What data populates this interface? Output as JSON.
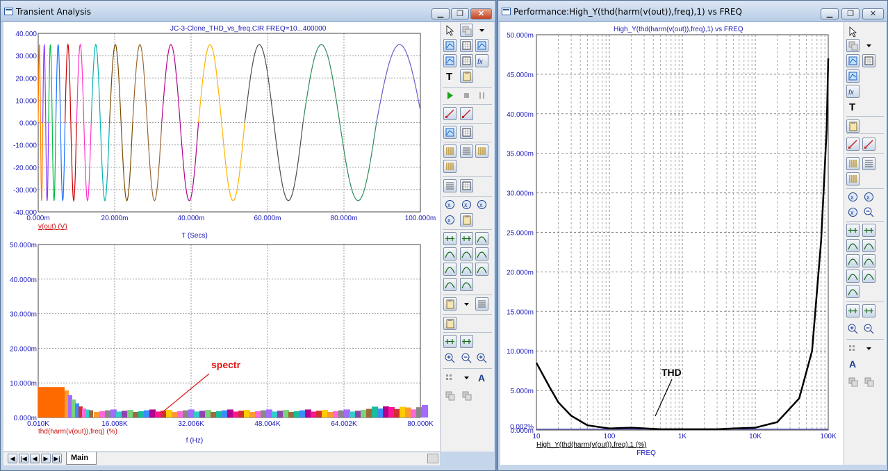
{
  "left_window": {
    "title": "Transient Analysis",
    "controls": [
      "minimize",
      "maximize",
      "close"
    ],
    "tabs": {
      "nav": [
        "first",
        "prev",
        "next",
        "last"
      ],
      "active": "Main"
    }
  },
  "right_window": {
    "title": "Performance:High_Y(thd(harm(v(out)),freq),1) vs FREQ",
    "controls": [
      "minimize",
      "maximize",
      "close"
    ]
  },
  "colors": {
    "grid": "#9a9a9a",
    "axis_text": "#1b1bb8",
    "trace_label": "#cc1111",
    "annotation": "#e01414",
    "performance_curve": "#000000"
  },
  "chart_data": [
    {
      "type": "line",
      "title": "JC-3-Clone_THD_vs_freq.CIR FREQ=10...400000",
      "xlabel": "T (Secs)",
      "trace_label": "v(out) (V)",
      "xlim": [
        0,
        0.1
      ],
      "ylim": [
        -40,
        40
      ],
      "x_ticks": [
        "0.000m",
        "20.000m",
        "40.000m",
        "60.000m",
        "80.000m",
        "100.000m"
      ],
      "y_ticks": [
        "40.000",
        "30.000",
        "20.000",
        "10.000",
        "0.000",
        "-10.000",
        "-20.000",
        "-30.000",
        "-40.000"
      ],
      "amplitude": 35,
      "series_note": "stepped sine sweep, many colored runs",
      "grid": true
    },
    {
      "type": "bar",
      "xlabel": "f (Hz)",
      "trace_label": "thd(harm(v(out)),freq) (%)",
      "xlim": [
        10,
        80000
      ],
      "ylim": [
        0,
        50
      ],
      "x_ticks": [
        "0.010K",
        "16.008K",
        "32.006K",
        "48.004K",
        "64.002K",
        "80.000K"
      ],
      "y_ticks": [
        "50.000m",
        "40.000m",
        "30.000m",
        "20.000m",
        "10.000m",
        "0.000m"
      ],
      "annotation": "spectr",
      "values_note": "~8.5 at lowest frequency falling to ~2 across the band",
      "grid": true
    },
    {
      "type": "line",
      "title": "High_Y(thd(harm(v(out)),freq),1) vs FREQ",
      "xlabel": "FREQ",
      "trace_label": "High_Y(thd(harm(v(out)),freq),1 (%)",
      "x_scale": "log",
      "xlim": [
        10,
        100000
      ],
      "ylim": [
        0,
        0.05
      ],
      "x_ticks": [
        "10",
        "100",
        "1K",
        "10K",
        "100K"
      ],
      "y_ticks": [
        "50.000m",
        "45.000m",
        "40.000m",
        "35.000m",
        "30.000m",
        "25.000m",
        "20.000m",
        "15.000m",
        "10.000m",
        "5.000m",
        "0.000m"
      ],
      "reference_label": "0,002%",
      "annotation": "THD",
      "points": [
        [
          10,
          0.0085
        ],
        [
          15,
          0.0055
        ],
        [
          20,
          0.0035
        ],
        [
          30,
          0.0018
        ],
        [
          50,
          0.0006
        ],
        [
          100,
          0.0002
        ],
        [
          200,
          0.0003
        ],
        [
          500,
          0.0001
        ],
        [
          1000,
          0.0001
        ],
        [
          3000,
          0.0001
        ],
        [
          5000,
          0.0002
        ],
        [
          10000,
          0.0003
        ],
        [
          20000,
          0.001
        ],
        [
          40000,
          0.004
        ],
        [
          60000,
          0.01
        ],
        [
          80000,
          0.024
        ],
        [
          95000,
          0.038
        ],
        [
          100000,
          0.047
        ]
      ],
      "grid": true
    }
  ]
}
